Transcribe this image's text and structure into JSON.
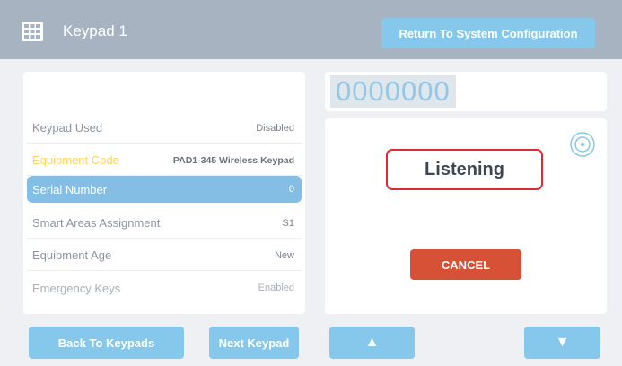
{
  "header": {
    "title": "Keypad 1",
    "return_label": "Return To System Configuration",
    "menu_icon": "grid-icon"
  },
  "details": {
    "rows": [
      {
        "label": "Keypad Used",
        "value": "Disabled"
      },
      {
        "label": "Equipment Code",
        "value": "PAD1-345 Wireless Keypad"
      },
      {
        "label": "Serial Number",
        "value": "0"
      },
      {
        "label": "Smart Areas Assignment",
        "value": "S1"
      },
      {
        "label": "Equipment Age",
        "value": "New"
      },
      {
        "label": "Emergency Keys",
        "value": "Enabled"
      }
    ]
  },
  "code": {
    "value": "0000000"
  },
  "listen": {
    "status": "Listening",
    "cancel_label": "CANCEL",
    "icon": "radar-icon"
  },
  "footer": {
    "back_label": "Back To Keypads",
    "next_label": "Next Keypad",
    "up_glyph": "▲",
    "down_glyph": "▼"
  },
  "colors": {
    "header": "#a7b3c1",
    "button": "#86c8ec",
    "selected_row": "#85bee5",
    "highlight_label": "#ffd45e",
    "cancel": "#d65136",
    "listening_border": "#d92c33"
  }
}
